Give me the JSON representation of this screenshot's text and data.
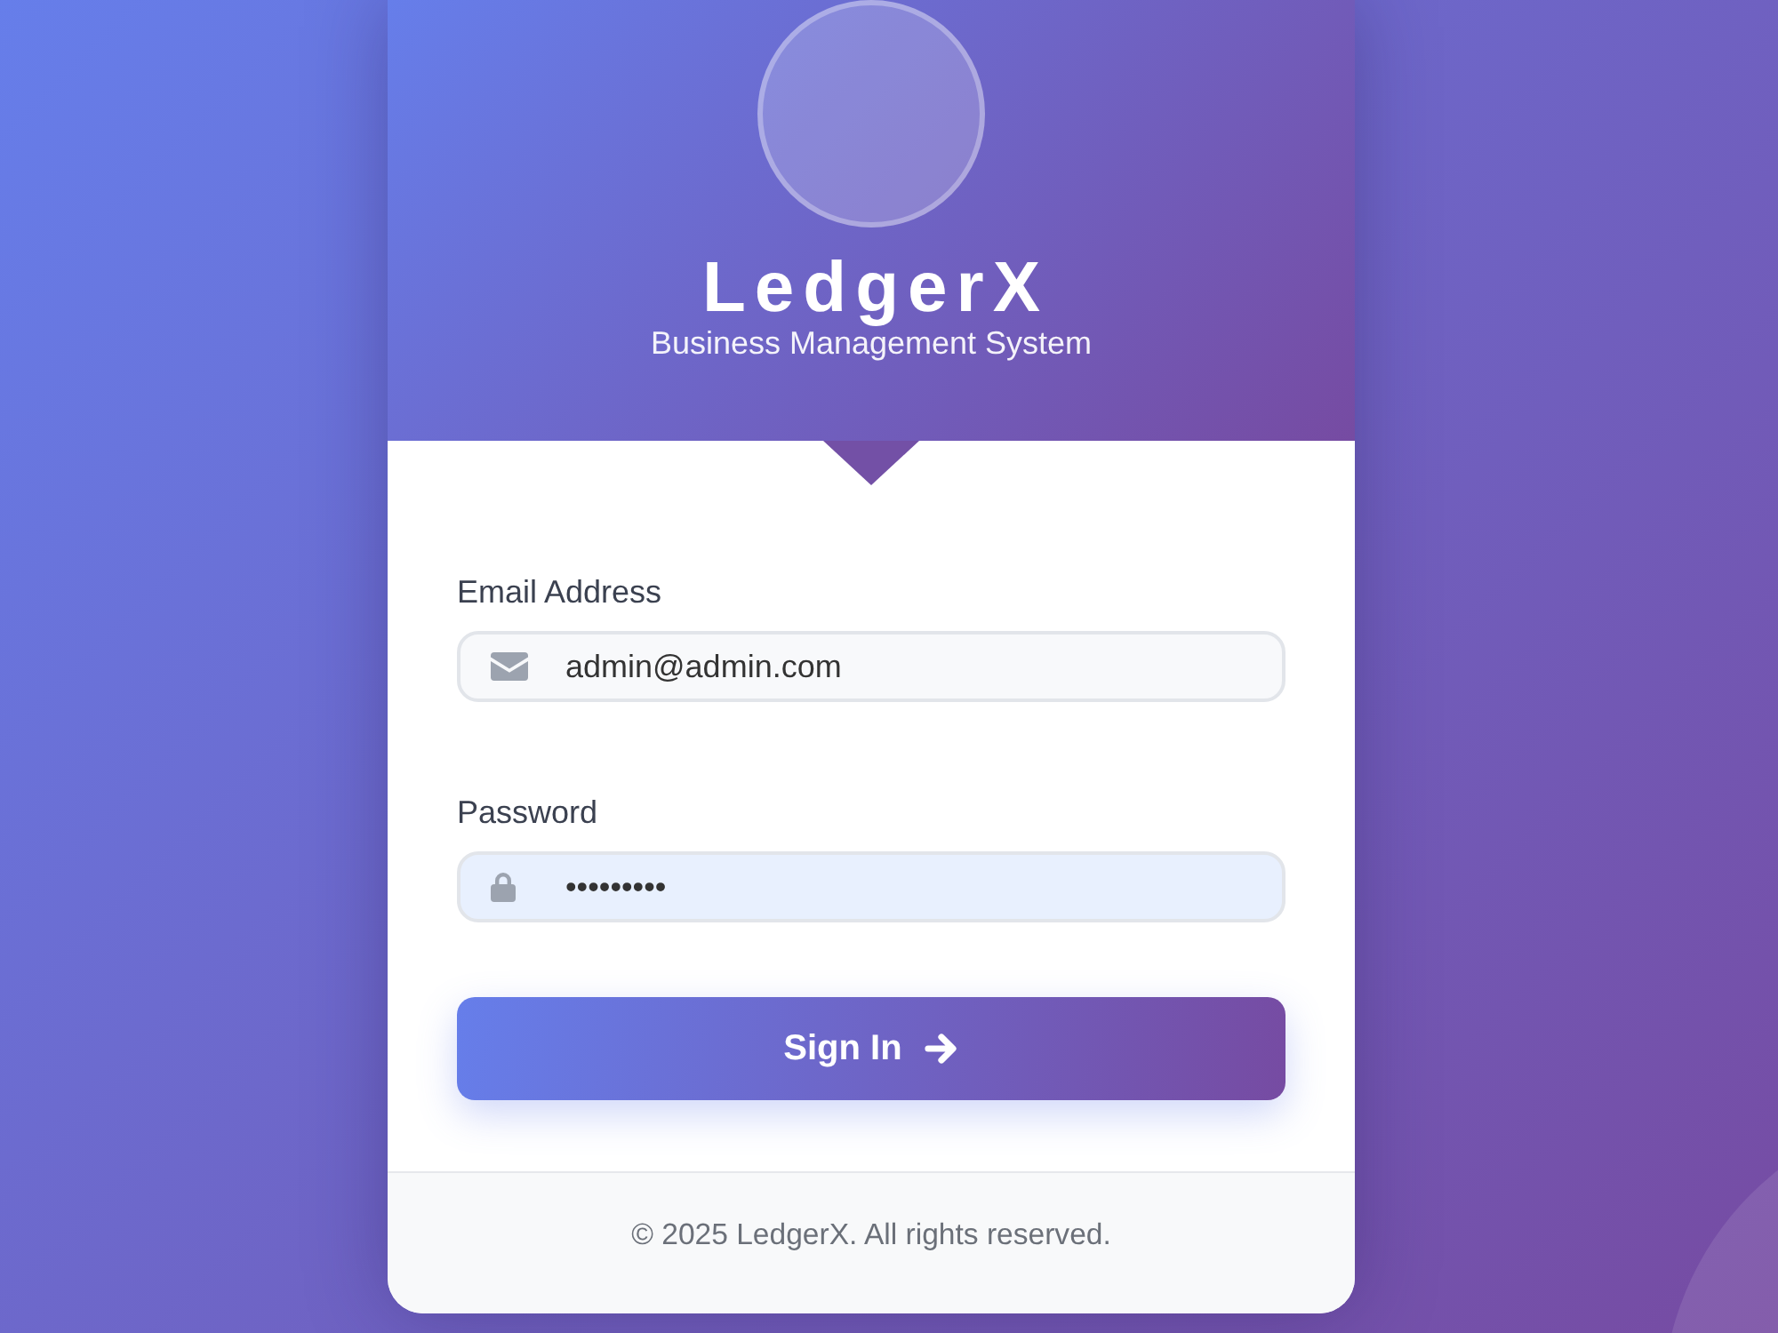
{
  "header": {
    "title": "LedgerX",
    "subtitle": "Business Management System"
  },
  "fields": [
    {
      "kind": "email",
      "label": "Email Address",
      "value": "admin@admin.com",
      "autofilled": false
    },
    {
      "kind": "password",
      "label": "Password",
      "value": "•••••••••",
      "autofilled": true
    }
  ],
  "submit": {
    "label": "Sign In"
  },
  "footer": {
    "text": "© 2025 LedgerX. All rights reserved."
  }
}
